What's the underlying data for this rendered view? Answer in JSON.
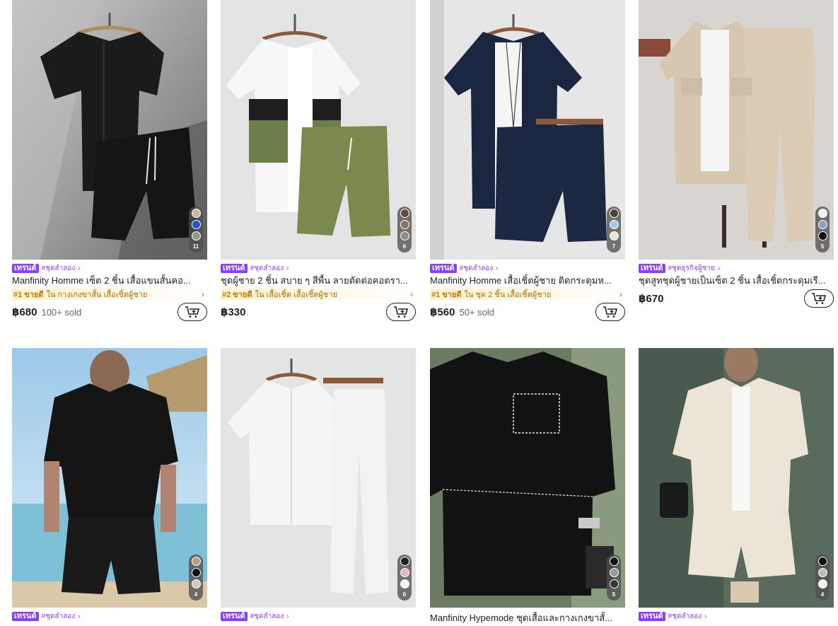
{
  "products": [
    {
      "trend_badge": "เทรนด์",
      "category": "#ชุดลำลอง",
      "title": "Manfinity Homme เซ็ต 2 ชิ้น เสื้อแขนสั้นคอ...",
      "rank": "#1 ขายดี",
      "rank_text": "ใน กางเกงขาสั้น เสื้อเชิ้ตผู้ชาย",
      "price": "฿680",
      "sold": "100+ sold",
      "swatch_count": "11",
      "swatches": [
        "#c9b8a8",
        "#1f55c9",
        "#8e9d80"
      ]
    },
    {
      "trend_badge": "เทรนด์",
      "category": "#ชุดลำลอง",
      "title": "ชุดผู้ชาย 2 ชิ้น สบาย ๆ สีพื้น ลายตัดต่อคอตรา...",
      "rank": "#2 ขายดี",
      "rank_text": "ใน เสื้อเชิ้ต เสื้อเชิ้ตผู้ชาย",
      "price": "฿330",
      "sold": "",
      "swatch_count": "6",
      "swatches": [
        "#6b4a3a",
        "#8a7560",
        "#8a8a8a"
      ]
    },
    {
      "trend_badge": "เทรนด์",
      "category": "#ชุดลำลอง",
      "title": "Manfinity Homme เสื้อเชิ้ตผู้ชาย ติดกระดุมห...",
      "rank": "#1 ขายดี",
      "rank_text": "ใน ชุด 2 ชิ้น เสื้อเชิ้ตผู้ชาย",
      "price": "฿560",
      "sold": "50+ sold",
      "swatch_count": "7",
      "swatches": [
        "#444444",
        "#a9c8e8",
        "#e8e3d3"
      ]
    },
    {
      "trend_badge": "เทรนด์",
      "category": "#ชุดธุรกิจผู้ชาย",
      "title": "ชุดสูทชุดผู้ชายเป็นเซ็ต 2 ชิ้น เสื้อเชิ้ตกระดุมเรี...",
      "rank": "",
      "rank_text": "",
      "price": "฿670",
      "sold": "",
      "swatch_count": "5",
      "swatches": [
        "#f0f0f0",
        "#8ea3c0",
        "#111111"
      ]
    },
    {
      "trend_badge": "เทรนด์",
      "category": "#ชุดลำลอง",
      "title": "",
      "rank": "",
      "rank_text": "",
      "price": "",
      "sold": "",
      "swatch_count": "4",
      "swatches": [
        "#bba27e",
        "#111111",
        "#d9c8b4"
      ]
    },
    {
      "trend_badge": "เทรนด์",
      "category": "#ชุดลำลอง",
      "title": "",
      "rank": "",
      "rank_text": "",
      "price": "",
      "sold": "",
      "swatch_count": "6",
      "swatches": [
        "#222222",
        "#e7b6c3",
        "#f4f4f4"
      ]
    },
    {
      "trend_badge": "",
      "category": "",
      "title": "Manfinity Hypemode ชุดเสื้อและกางเกงขาสั้...",
      "rank": "",
      "rank_text": "",
      "price": "",
      "sold": "",
      "swatch_count": "5",
      "swatches": [
        "#111111",
        "#9a9a9a",
        "#2f3a2a"
      ]
    },
    {
      "trend_badge": "เทรนด์",
      "category": "#ชุดลำลอง",
      "title": "",
      "rank": "",
      "rank_text": "",
      "price": "",
      "sold": "",
      "swatch_count": "4",
      "swatches": [
        "#111111",
        "#bdbdbd",
        "#f2f2f2"
      ]
    }
  ],
  "icons": {
    "cart": "add-to-cart-icon",
    "arrow": "chevron-right-icon"
  },
  "colors": {
    "trend_badge": "#8a3ffc",
    "rank_bg": "#fff3cd",
    "rank_text": "#c77700"
  }
}
